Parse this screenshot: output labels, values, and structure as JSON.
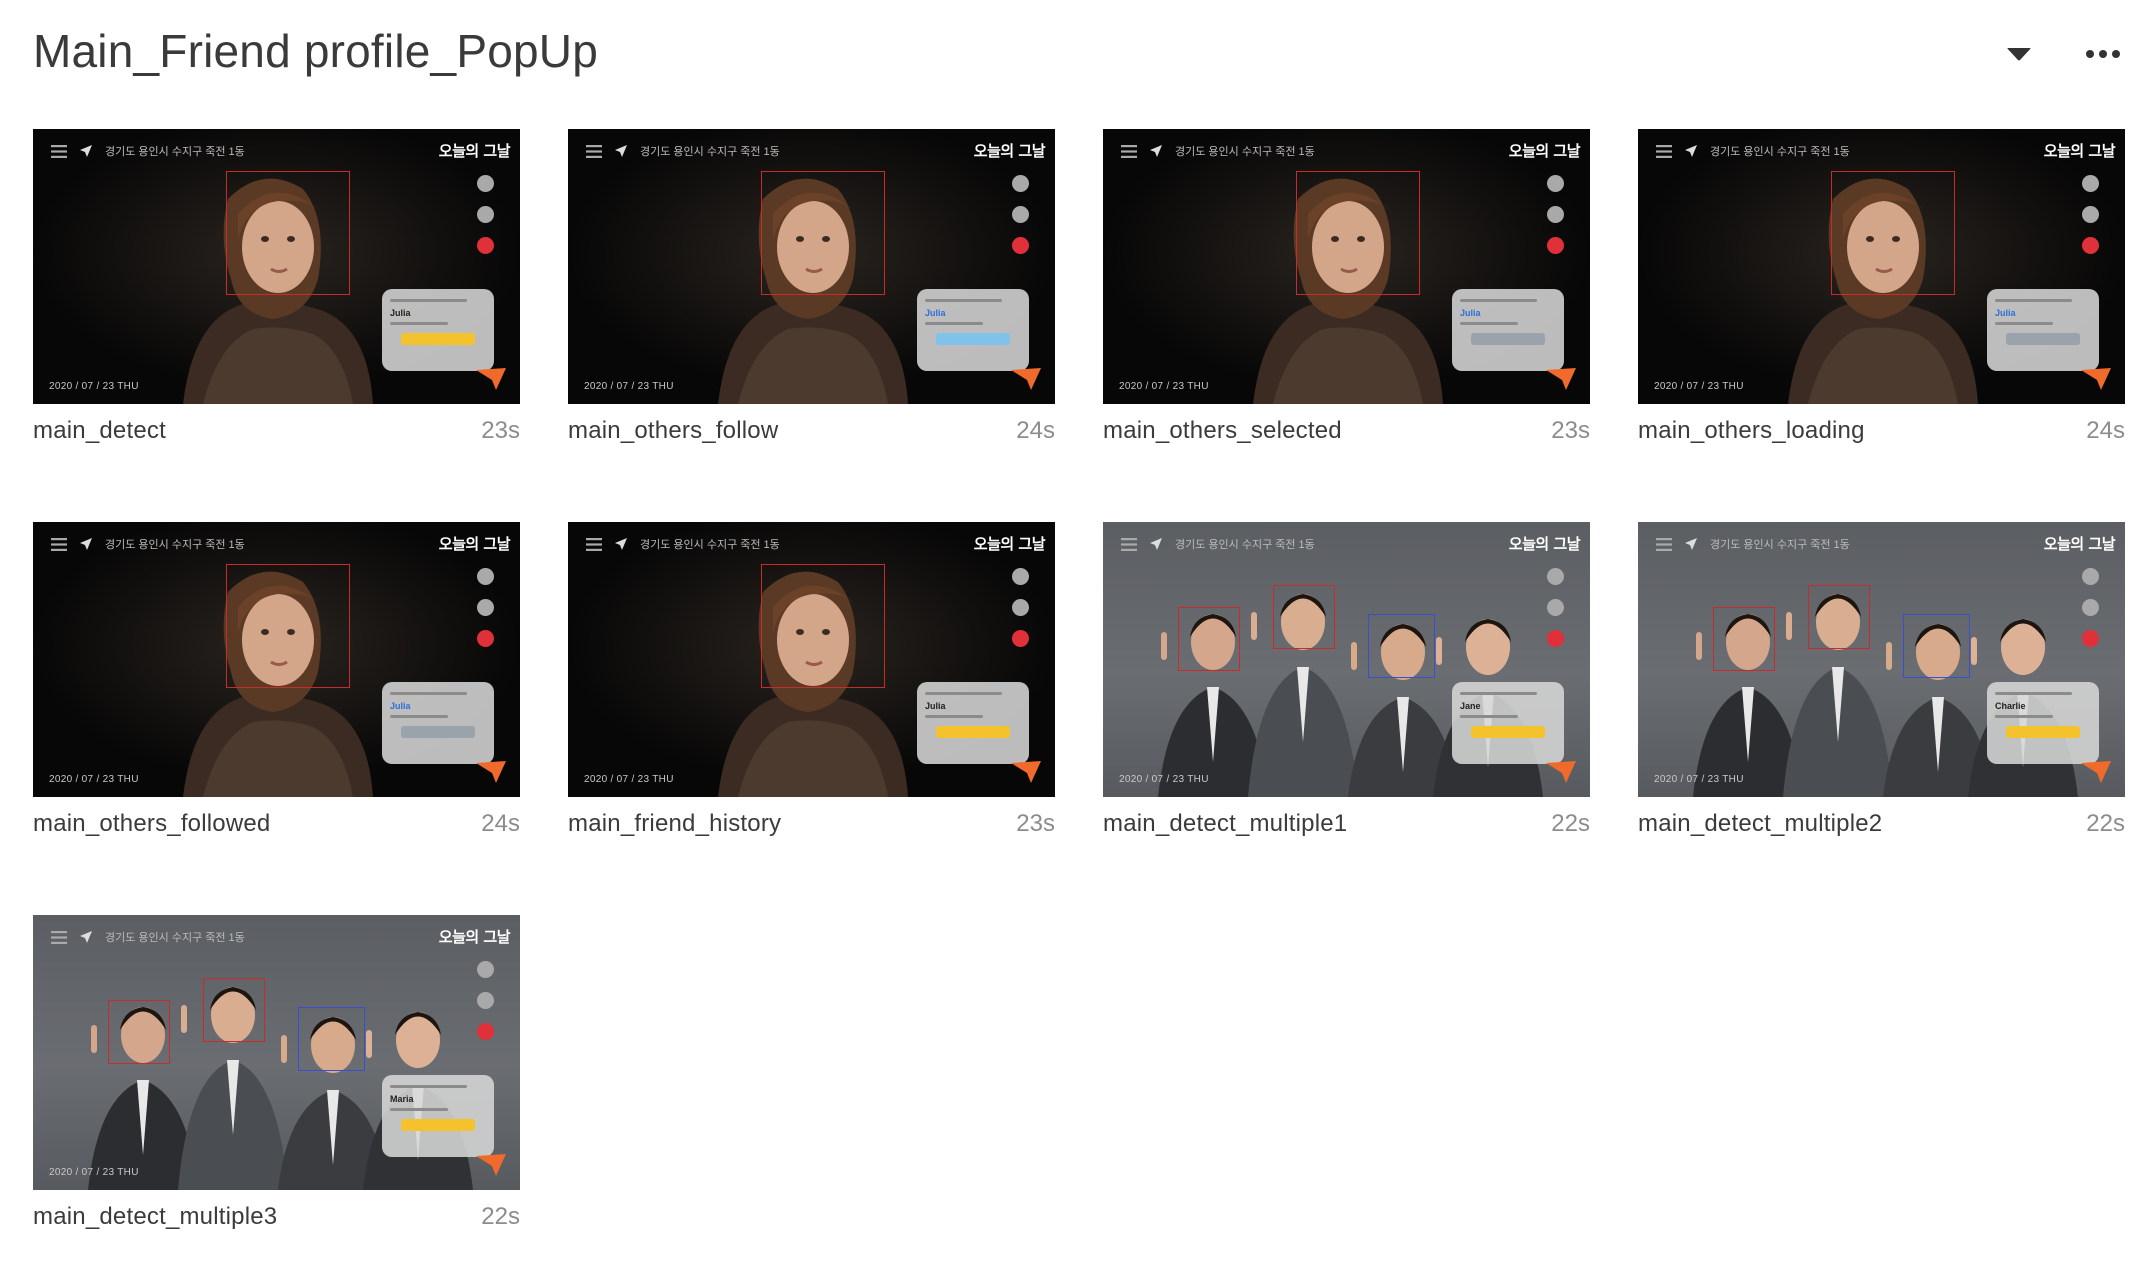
{
  "header": {
    "title": "Main_Friend profile_PopUp",
    "dropdown_icon": "caret-down-icon",
    "more_icon": "ellipsis-icon"
  },
  "thumbnail_common": {
    "location": "경기도 용인시 수지구 죽전 1동",
    "brand": "오늘의 그날",
    "date": "2020 / 07 / 23   THU"
  },
  "colors": {
    "face_box_red": "#c92a2a",
    "face_box_blue": "#3a4fd0",
    "popup_yellow": "#f3c22d",
    "popup_blue": "#7fc3ea",
    "cursor_orange": "#f06a2b",
    "side_red": "#e0303a"
  },
  "cards": [
    {
      "title": "main_detect",
      "duration": "23s",
      "scene": "portrait",
      "popup_name": "Julia",
      "popup_button": "yellow"
    },
    {
      "title": "main_others_follow",
      "duration": "24s",
      "scene": "portrait",
      "popup_name": "Julia",
      "popup_button": "blue"
    },
    {
      "title": "main_others_selected",
      "duration": "23s",
      "scene": "portrait",
      "popup_name": "Julia",
      "popup_button": "gray"
    },
    {
      "title": "main_others_loading",
      "duration": "24s",
      "scene": "portrait",
      "popup_name": "Julia",
      "popup_button": "gray"
    },
    {
      "title": "main_others_followed",
      "duration": "24s",
      "scene": "portrait",
      "popup_name": "Julia",
      "popup_button": "gray"
    },
    {
      "title": "main_friend_history",
      "duration": "23s",
      "scene": "portrait",
      "popup_name": "Julia",
      "popup_button": "yellow"
    },
    {
      "title": "main_detect_multiple1",
      "duration": "22s",
      "scene": "group",
      "popup_name": "Jane",
      "popup_button": "yellow"
    },
    {
      "title": "main_detect_multiple2",
      "duration": "22s",
      "scene": "group",
      "popup_name": "Charlie",
      "popup_button": "yellow"
    },
    {
      "title": "main_detect_multiple3",
      "duration": "22s",
      "scene": "group",
      "popup_name": "Maria",
      "popup_button": "yellow"
    }
  ]
}
